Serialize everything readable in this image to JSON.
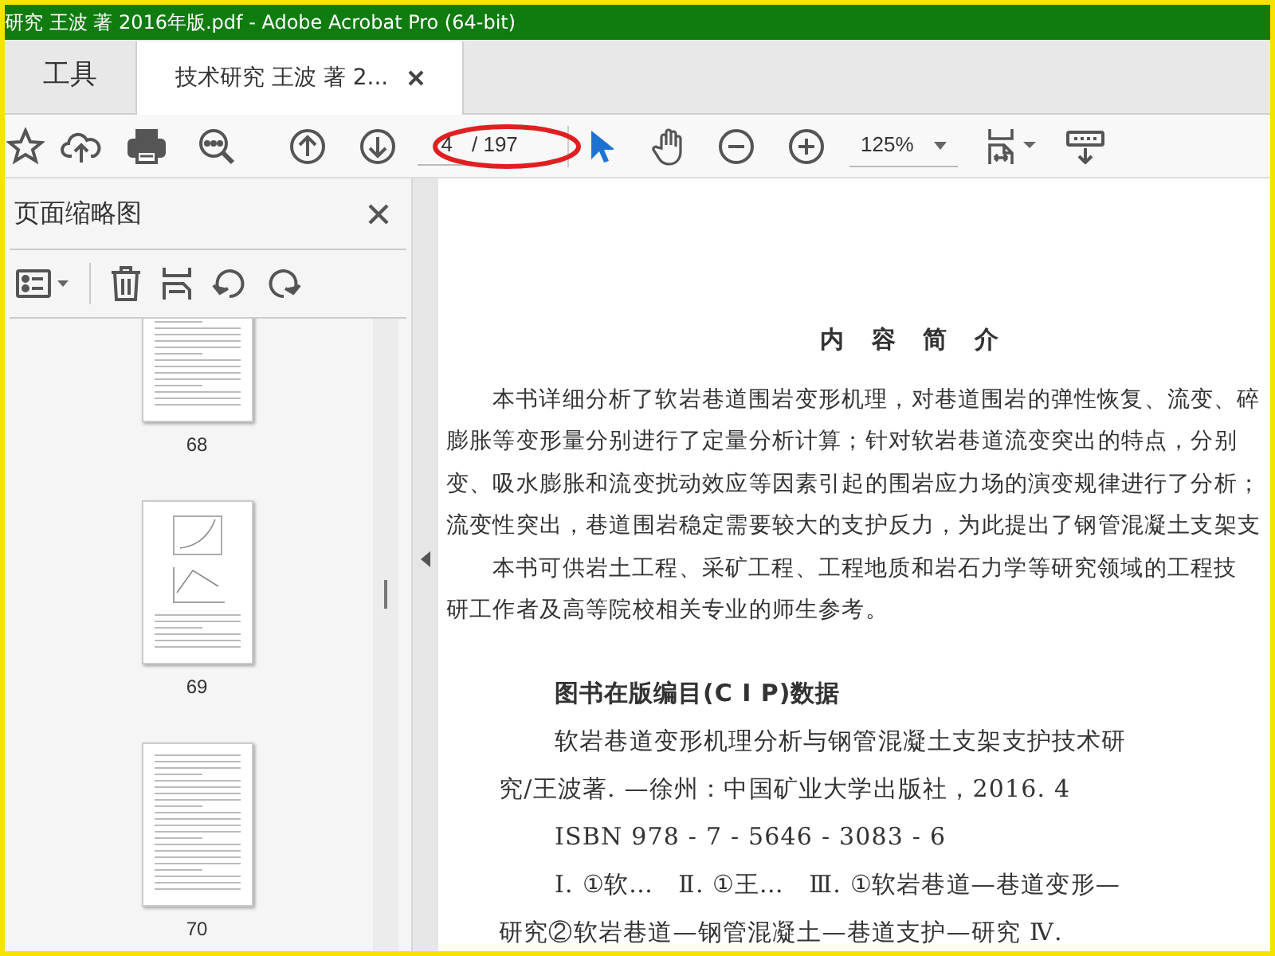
{
  "window": {
    "title": "研究 王波 著 2016年版.pdf - Adobe Acrobat Pro (64-bit)"
  },
  "tabs": [
    {
      "label": "工具",
      "selected": false
    },
    {
      "label": "技术研究 王波 著 2...",
      "selected": true
    }
  ],
  "toolbar": {
    "page_number": "4",
    "page_count": "/ 197",
    "zoom": "125%",
    "tools": [
      {
        "kind": "select",
        "selected": true
      },
      {
        "kind": "hand",
        "selected": false
      }
    ]
  },
  "sidebar": {
    "title": "页面缩略图",
    "thumbnails": [
      {
        "label": "68",
        "kind": "text"
      },
      {
        "label": "69",
        "kind": "figure"
      },
      {
        "label": "70",
        "kind": "text"
      }
    ]
  },
  "document": {
    "summary_title": "内 容 简 介",
    "summary_lines": [
      {
        "text": "本书详细分析了软岩巷道围岩变形机理，对巷道围岩的弹性恢复、流变、碎",
        "kind": "indent"
      },
      {
        "text": "膨胀等变形量分别进行了定量分析计算；针对软岩巷道流变突出的特点，分别",
        "kind": "plain"
      },
      {
        "text": "变、吸水膨胀和流变扰动效应等因素引起的围岩应力场的演变规律进行了分析；",
        "kind": "plain"
      },
      {
        "text": "流变性突出，巷道围岩稳定需要较大的支护反力，为此提出了钢管混凝土支架支",
        "kind": "plain"
      },
      {
        "text": "本书可供岩土工程、采矿工程、工程地质和岩石力学等研究领域的工程技",
        "kind": "indent"
      },
      {
        "text": "研工作者及高等院校相关专业的师生参考。",
        "kind": "plain"
      }
    ],
    "cip_title": "图书在版编目(C I P)数据",
    "cip_lines": [
      {
        "text": "软岩巷道变形机理分析与钢管混凝土支架支护技术研",
        "kind": "indent"
      },
      {
        "text": "究/王波著. —徐州：中国矿业大学出版社，2016. 4",
        "kind": "plain"
      },
      {
        "text": "ISBN 978 - 7 - 5646 - 3083 - 6",
        "kind": "indent"
      },
      {
        "text": "Ⅰ. ①软…　Ⅱ. ①王…　Ⅲ. ①软岩巷道—巷道变形—",
        "kind": "indent"
      },
      {
        "text": "研究②软岩巷道—钢管混凝土—巷道支护—研究 Ⅳ.",
        "kind": "plain"
      }
    ]
  }
}
